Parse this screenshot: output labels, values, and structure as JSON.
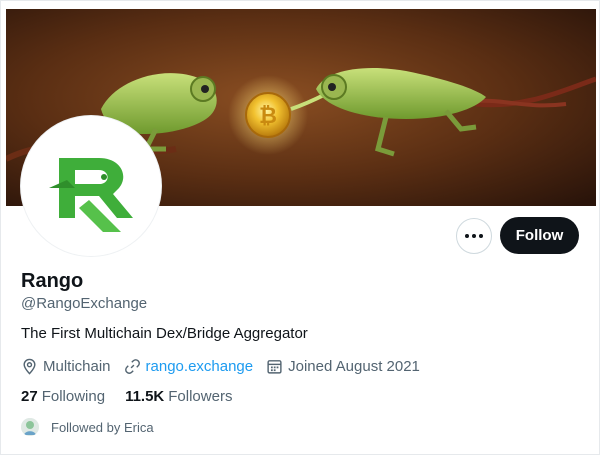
{
  "profile": {
    "name": "Rango",
    "handle": "@RangoExchange",
    "bio": "The First Multichain Dex/Bridge Aggregator",
    "location": "Multichain",
    "website": "rango.exchange",
    "joined": "Joined August 2021"
  },
  "stats": {
    "following_count": "27",
    "following_label": "Following",
    "followers_count": "11.5K",
    "followers_label": "Followers"
  },
  "followed_by": "Followed by Erica",
  "actions": {
    "follow_label": "Follow",
    "more_icon": "more-icon"
  },
  "banner": {
    "description_icon": "bitcoin-coin"
  },
  "colors": {
    "brand_green": "#3fae3a",
    "follow_button": "#0f1419",
    "link": "#1d9bf0",
    "secondary_text": "#536471"
  }
}
